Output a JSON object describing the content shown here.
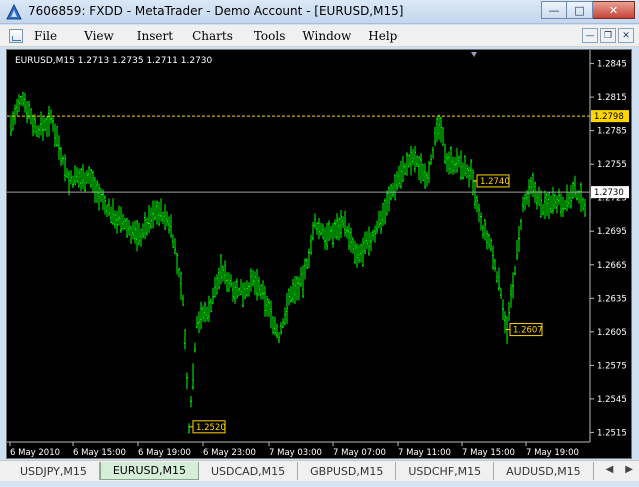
{
  "window": {
    "title": "7606859: FXDD - MetaTrader - Demo Account - [EURUSD,M15]",
    "minimize_icon": "minimize-icon",
    "maximize_icon": "maximize-icon",
    "close_icon": "close-icon"
  },
  "menu": {
    "items": [
      "File",
      "View",
      "Insert",
      "Charts",
      "Tools",
      "Window",
      "Help"
    ]
  },
  "chart": {
    "header": "EURUSD,M15  1.2713 1.2735 1.2711 1.2730",
    "price_labels": [
      "1.2845",
      "1.2815",
      "1.2785",
      "1.2755",
      "1.2725",
      "1.2695",
      "1.2665",
      "1.2635",
      "1.2605",
      "1.2575",
      "1.2545",
      "1.2515"
    ],
    "time_labels": [
      "6 May 2010",
      "6 May 15:00",
      "6 May 19:00",
      "6 May 23:00",
      "7 May 03:00",
      "7 May 07:00",
      "7 May 11:00",
      "7 May 15:00",
      "7 May 19:00"
    ],
    "current_price": "1.2730",
    "level_line": "1.2798",
    "markers": [
      "1.2520",
      "1.2740",
      "1.2607"
    ],
    "colors": {
      "candles": "#00ff00",
      "level": "#ffd700",
      "bid": "#a0a0a0",
      "background": "#000000",
      "grid_text": "#ffffff"
    }
  },
  "chart_data": {
    "type": "line",
    "title": "EURUSD,M15",
    "series": [
      {
        "name": "EURUSD,M15",
        "x": [
          "6 May 2010",
          "6 May 15:00",
          "6 May 19:00",
          "6 May 23:00",
          "7 May 03:00",
          "7 May 07:00",
          "7 May 11:00",
          "7 May 15:00",
          "7 May 19:00"
        ],
        "values": [
          1.28,
          1.272,
          1.268,
          1.263,
          1.269,
          1.271,
          1.277,
          1.264,
          1.273
        ]
      }
    ],
    "ylim": [
      1.251,
      1.285
    ],
    "grid": false,
    "markers": [
      1.252,
      1.274,
      1.2607
    ],
    "level": 1.2798,
    "current": 1.273
  },
  "tabs": {
    "items": [
      "USDJPY,M15",
      "EURUSD,M15",
      "USDCAD,M15",
      "GBPUSD,M15",
      "USDCHF,M15",
      "AUDUSD,M15"
    ],
    "active": "EURUSD,M15"
  }
}
